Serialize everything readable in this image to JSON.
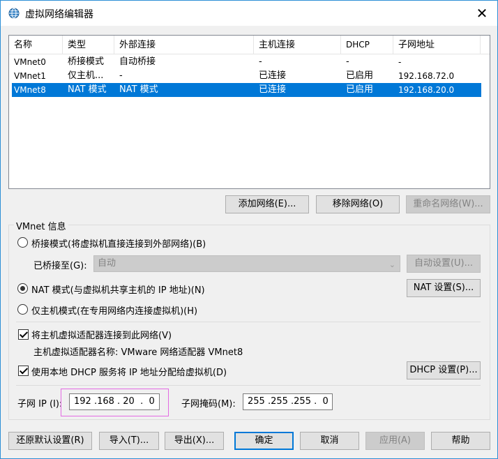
{
  "window": {
    "title": "虚拟网络编辑器",
    "close_glyph": "✕"
  },
  "table": {
    "headers": [
      "名称",
      "类型",
      "外部连接",
      "主机连接",
      "DHCP",
      "子网地址"
    ],
    "rows": [
      [
        "VMnet0",
        "桥接模式",
        "自动桥接",
        "-",
        "-",
        "-"
      ],
      [
        "VMnet1",
        "仅主机...",
        "-",
        "已连接",
        "已启用",
        "192.168.72.0"
      ],
      [
        "VMnet8",
        "NAT 模式",
        "NAT 模式",
        "已连接",
        "已启用",
        "192.168.20.0"
      ]
    ],
    "selected_row": 2
  },
  "list_buttons": {
    "add": "添加网络(E)...",
    "remove": "移除网络(O)",
    "rename": "重命名网络(W)..."
  },
  "info": {
    "group_title": "VMnet 信息",
    "bridge_radio": "桥接模式(将虚拟机直接连接到外部网络)(B)",
    "bridged_to_label": "已桥接至(G):",
    "bridged_to_value": "自动",
    "auto_settings": "自动设置(U)...",
    "nat_radio": "NAT 模式(与虚拟机共享主机的 IP 地址)(N)",
    "nat_settings": "NAT 设置(S)...",
    "hostonly_radio": "仅主机模式(在专用网络内连接虚拟机)(H)",
    "connect_adapter_check": "将主机虚拟适配器连接到此网络(V)",
    "adapter_name_text": "主机虚拟适配器名称: VMware 网络适配器 VMnet8",
    "dhcp_check": "使用本地 DHCP 服务将 IP 地址分配给虚拟机(D)",
    "dhcp_settings": "DHCP 设置(P)...",
    "subnet_ip_label": "子网 IP (I):",
    "subnet_ip_value": "192 .168 . 20  .  0",
    "subnet_mask_label": "子网掩码(M):",
    "subnet_mask_value": "255 .255 .255 .  0",
    "selected_mode": "nat"
  },
  "footer": {
    "restore": "还原默认设置(R)",
    "import": "导入(T)...",
    "export": "导出(X)...",
    "ok": "确定",
    "cancel": "取消",
    "apply": "应用(A)",
    "help": "帮助"
  },
  "colors": {
    "selection": "#0078d7",
    "highlight_box": "#e36ae3"
  }
}
